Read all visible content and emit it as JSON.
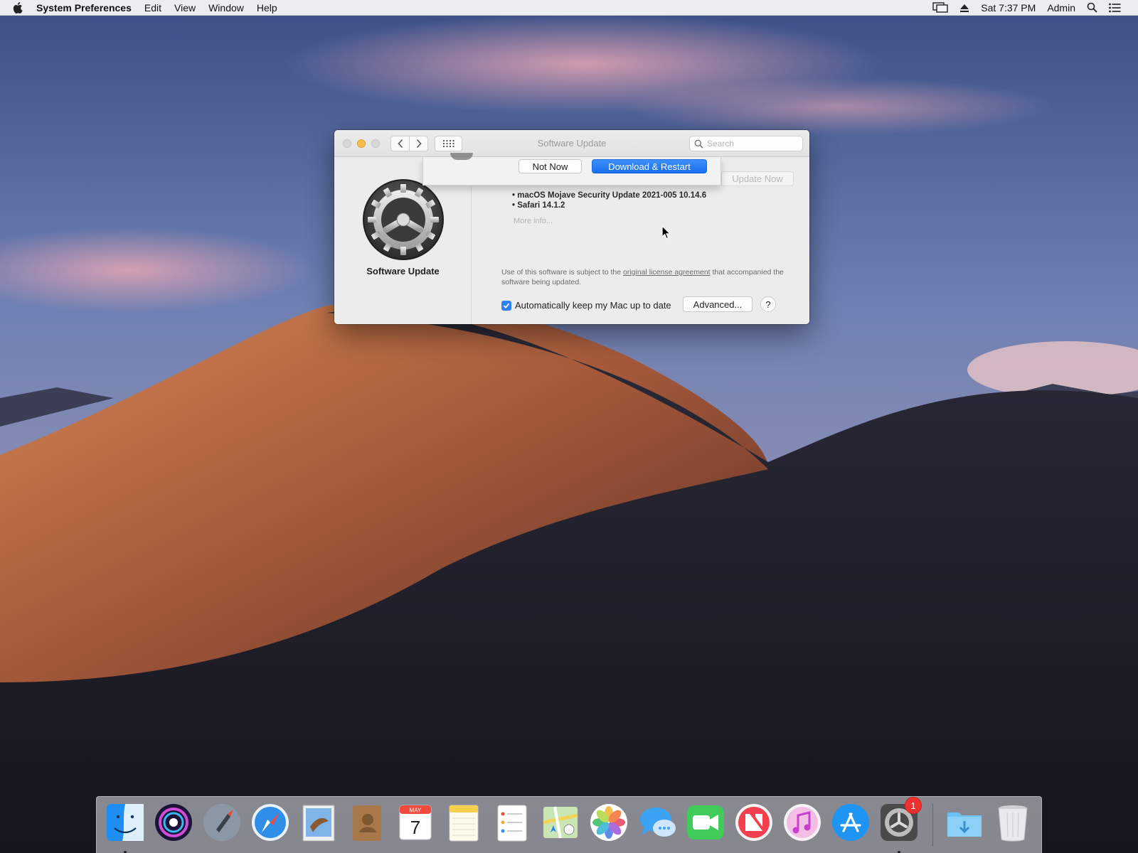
{
  "menubar": {
    "app_name": "System Preferences",
    "menus": [
      "Edit",
      "View",
      "Window",
      "Help"
    ],
    "clock": "Sat 7:37 PM",
    "user": "Admin"
  },
  "window": {
    "title": "Software Update",
    "search_placeholder": "Search",
    "sidebar_title": "Software Update",
    "update_now_label": "Update Now",
    "updates": [
      "• macOS Mojave Security Update 2021-005 10.14.6",
      "• Safari 14.1.2"
    ],
    "more_info": "More info...",
    "license_prefix": "Use of this software is subject to the",
    "license_link": "original license agreement",
    "license_suffix": "that accompanied the software being updated.",
    "auto_update_label": "Automatically keep my Mac up to date",
    "auto_update_checked": true,
    "advanced_label": "Advanced...",
    "help_label": "?"
  },
  "sheet": {
    "not_now_label": "Not Now",
    "download_restart_label": "Download & Restart"
  },
  "dock": {
    "calendar_month": "MAY",
    "calendar_day": "7",
    "prefs_badge": "1",
    "items": [
      "finder-icon",
      "siri-icon",
      "launchpad-icon",
      "safari-icon",
      "mail-icon",
      "contacts-icon",
      "calendar-icon",
      "notes-icon",
      "reminders-icon",
      "maps-icon",
      "photos-icon",
      "messages-icon",
      "facetime-icon",
      "news-icon",
      "itunes-icon",
      "app-store-icon",
      "system-preferences-icon",
      "downloads-folder-icon",
      "trash-icon"
    ]
  },
  "colors": {
    "accent": "#1a6ff0",
    "badge": "#f0302f",
    "minimize": "#f5bd4f"
  }
}
